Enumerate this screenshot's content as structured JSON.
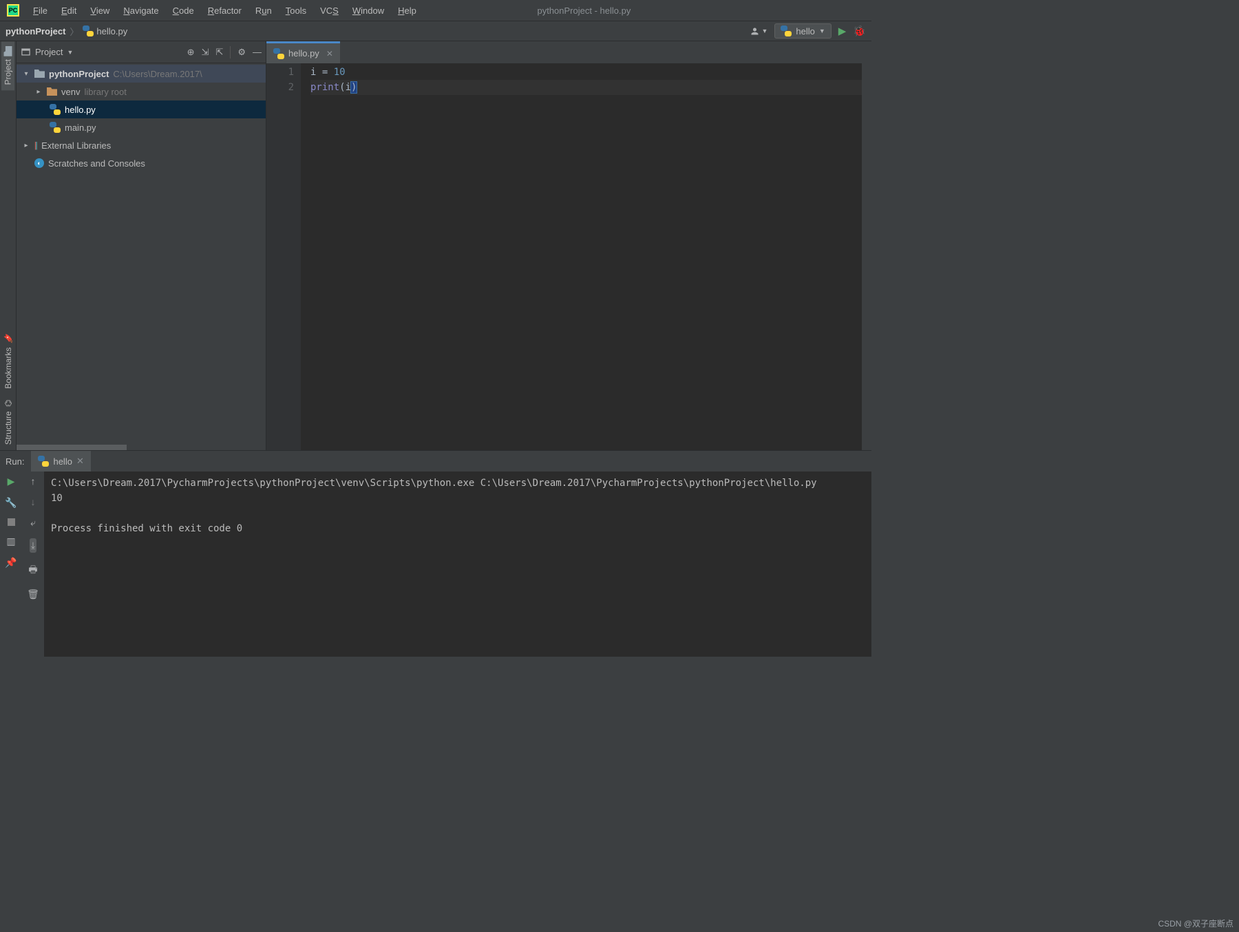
{
  "menu": {
    "file": "File",
    "edit": "Edit",
    "view": "View",
    "navigate": "Navigate",
    "code": "Code",
    "refactor": "Refactor",
    "run": "Run",
    "tools": "Tools",
    "vcs": "VCS",
    "window": "Window",
    "help": "Help"
  },
  "window_title": "pythonProject - hello.py",
  "breadcrumb": {
    "project": "pythonProject",
    "file": "hello.py"
  },
  "run_config": {
    "name": "hello"
  },
  "sidebar": {
    "title": "Project",
    "root": {
      "name": "pythonProject",
      "path": "C:\\Users\\Dream.2017\\"
    },
    "venv": {
      "name": "venv",
      "hint": "library root"
    },
    "files": [
      "hello.py",
      "main.py"
    ],
    "external": "External Libraries",
    "scratches": "Scratches and Consoles"
  },
  "left_tabs": {
    "project": "Project",
    "bookmarks": "Bookmarks",
    "structure": "Structure"
  },
  "editor": {
    "tab": "hello.py",
    "lines": [
      "1",
      "2"
    ],
    "code": {
      "l1_var": "i",
      "l1_op": " = ",
      "l1_val": "10",
      "l2_func": "print",
      "l2_open": "(",
      "l2_arg": "i",
      "l2_close": ")"
    }
  },
  "run_panel": {
    "label": "Run:",
    "tab": "hello",
    "output_cmd": "C:\\Users\\Dream.2017\\PycharmProjects\\pythonProject\\venv\\Scripts\\python.exe C:\\Users\\Dream.2017\\PycharmProjects\\pythonProject\\hello.py",
    "output_val": "10",
    "output_exit": "Process finished with exit code 0"
  },
  "watermark": "CSDN @双子座断点"
}
